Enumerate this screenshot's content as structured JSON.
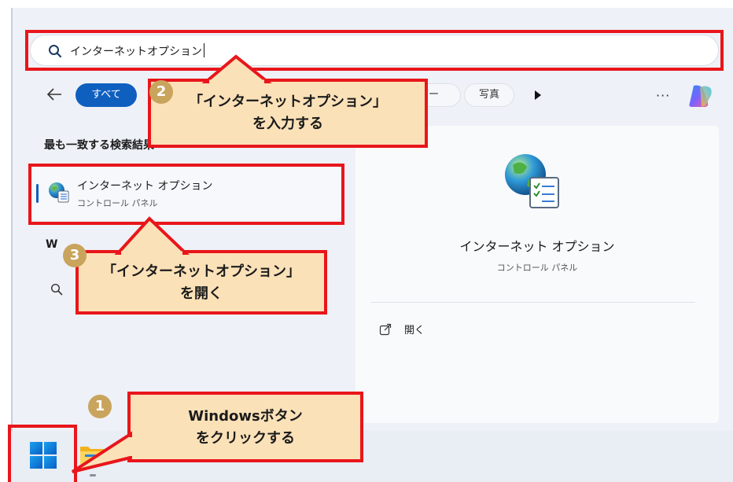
{
  "search": {
    "value": "インターネットオプション"
  },
  "filters": {
    "all_label": "すべて",
    "folders_label": "ダー",
    "photos_label": "写真"
  },
  "best_match": {
    "title": "最も一致する検索結果",
    "item": {
      "name": "インターネット オプション",
      "subtitle": "コントロール パネル"
    }
  },
  "web_search": {
    "title": "W"
  },
  "detail": {
    "title": "インターネット オプション",
    "subtitle": "コントロール パネル",
    "open_label": "開く"
  },
  "callouts": {
    "step2": {
      "badge": "2",
      "line1": "「インターネットオプション」",
      "line2": "を入力する"
    },
    "step3": {
      "badge": "3",
      "line1": "「インターネットオプション」",
      "line2": "を開く"
    },
    "step1": {
      "badge": "1",
      "line1": "Windowsボタン",
      "line2": "をクリックする"
    }
  },
  "icons": {
    "search": "search-icon",
    "back": "back-arrow-icon",
    "play": "play-icon",
    "more": "more-icon",
    "copilot": "copilot-icon",
    "internet_options": "internet-options-icon",
    "open": "open-external-icon",
    "windows": "windows-start-icon",
    "folder": "file-explorer-icon"
  },
  "colors": {
    "highlight": "#e8161b",
    "accent": "#0f5fbf",
    "callout_bg": "#fbe1b8",
    "badge": "#c9a45d"
  }
}
